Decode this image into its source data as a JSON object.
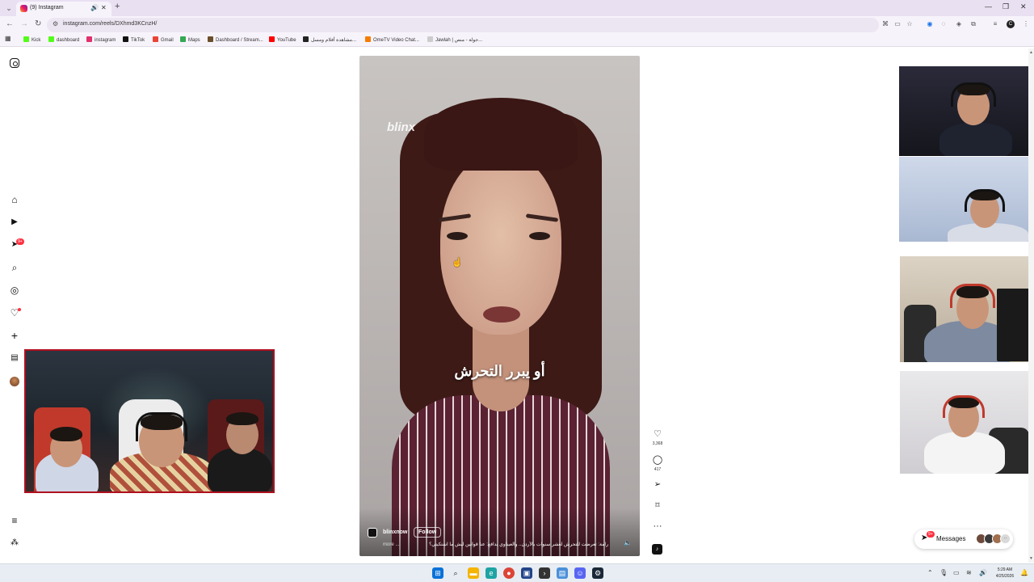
{
  "browser": {
    "tab": {
      "title": "(9) Instagram"
    },
    "address": {
      "url": "instagram.com/reels/DXhmd3KCnzH/"
    },
    "profile_initial": "C",
    "bookmarks": [
      {
        "label": "Kick",
        "color": "#53fc18"
      },
      {
        "label": "dashboard",
        "color": "#53fc18"
      },
      {
        "label": "instagram",
        "color": "#e1306c"
      },
      {
        "label": "TikTok",
        "color": "#111111"
      },
      {
        "label": "Gmail",
        "color": "#ea4335"
      },
      {
        "label": "Maps",
        "color": "#34a853"
      },
      {
        "label": "Dashboard / Stream...",
        "color": "#6b4f2a"
      },
      {
        "label": "YouTube",
        "color": "#ff0000"
      },
      {
        "label": "مشاهدة أفلام ومسل...",
        "color": "#222222"
      },
      {
        "label": "OmeTV Video Chat...",
        "color": "#f57c00"
      },
      {
        "label": "Jawlah | جولة - منص...",
        "color": "#cccccc"
      }
    ]
  },
  "instagram": {
    "rail": {
      "notifications_badge": "9+"
    },
    "reel": {
      "watermark": "blinx",
      "caption_overlay": "أو يبرر التحرش",
      "username": "blinxnow",
      "follow_label": "Follow",
      "description": "رامة: تعرضت للتحرش لعشر سنوات بالأردن.. والعيناوي يدافع: عنا قوانين ليش ما اشتكيتي؟",
      "more_label": "more ..."
    },
    "actions": {
      "likes": "3,368",
      "comments": "417"
    },
    "messages": {
      "label": "Messages",
      "badge": "9+"
    }
  },
  "taskbar": {
    "time": "5:29 AM",
    "date": "4/25/2026"
  }
}
